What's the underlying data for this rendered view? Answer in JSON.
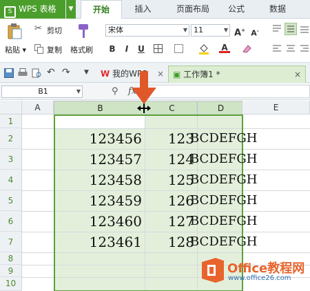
{
  "app": {
    "name": "WPS 表格",
    "menu_tabs": [
      "开始",
      "插入",
      "页面布局",
      "公式",
      "数据"
    ],
    "active_tab": "开始"
  },
  "ribbon": {
    "paste": "粘贴",
    "cut": "剪切",
    "copy": "复制",
    "format_painter": "格式刷",
    "font_name": "宋体",
    "font_size": "11",
    "bold": "B",
    "italic": "I",
    "underline": "U"
  },
  "doc_tabs": [
    {
      "label": "我的WPS"
    },
    {
      "label": "工作簿1 *"
    }
  ],
  "formula_bar": {
    "name_box": "B1",
    "fx": "fx"
  },
  "sheet": {
    "columns": [
      "A",
      "B",
      "C",
      "D",
      "E"
    ],
    "rows": [
      "1",
      "2",
      "3",
      "4",
      "5",
      "6",
      "7",
      "8",
      "9",
      "10"
    ],
    "data": [
      {
        "b": "",
        "c": "",
        "d": ""
      },
      {
        "b": "123456",
        "c": "123",
        "d": "BCDEFGH"
      },
      {
        "b": "123457",
        "c": "124",
        "d": "BCDEFGH"
      },
      {
        "b": "123458",
        "c": "125",
        "d": "BCDEFGH"
      },
      {
        "b": "123459",
        "c": "126",
        "d": "BCDEFGH"
      },
      {
        "b": "123460",
        "c": "127",
        "d": "BCDEFGH"
      },
      {
        "b": "123461",
        "c": "128",
        "d": "BCDEFGH"
      }
    ]
  },
  "watermark": {
    "brand": "Office教程网",
    "url": "www.office26.com"
  },
  "colors": {
    "wps_green": "#4c9e2c",
    "selection": "#e3efdb",
    "arrow": "#e0572a"
  }
}
